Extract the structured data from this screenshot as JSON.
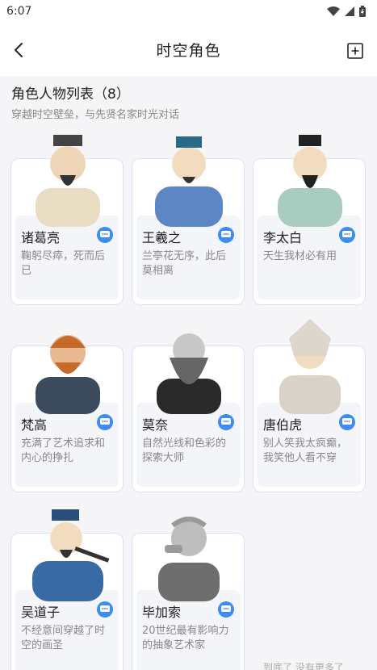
{
  "status": {
    "time": "6:07"
  },
  "appbar": {
    "title": "时空角色"
  },
  "section": {
    "title": "角色人物列表（8）",
    "subtitle": "穿越时空壁垒，与先贤名家时光对话"
  },
  "characters": [
    {
      "name": "诸葛亮",
      "desc": "鞠躬尽瘁，死而后已",
      "robe": "#e8dcc2",
      "hat": "#444"
    },
    {
      "name": "王羲之",
      "desc": "兰亭花无序，此后莫相离",
      "robe": "#5c86c4",
      "hat": "#2a6a88"
    },
    {
      "name": "李太白",
      "desc": "天生我材必有用",
      "robe": "#a9ccc0",
      "hat": "#222"
    },
    {
      "name": "梵高",
      "desc": "充满了艺术追求和内心的挣扎",
      "robe": "#3c4a5e",
      "hat": "#c66a2a"
    },
    {
      "name": "莫奈",
      "desc": "自然光线和色彩的探索大师",
      "robe": "#2a2a2a",
      "hat": "#666"
    },
    {
      "name": "唐伯虎",
      "desc": "别人笑我太疯癫，我笑他人看不穿",
      "robe": "#d8d2c8",
      "hat": "#dcd6cc"
    },
    {
      "name": "吴道子",
      "desc": "不经意间穿越了时空的画圣",
      "robe": "#3a6aa4",
      "hat": "#2a4e7a"
    },
    {
      "name": "毕加索",
      "desc": "20世纪最有影响力的抽象艺术家",
      "robe": "#6e6e6e",
      "hat": "#999"
    }
  ],
  "footer": {
    "text": "到底了 没有更多了"
  }
}
